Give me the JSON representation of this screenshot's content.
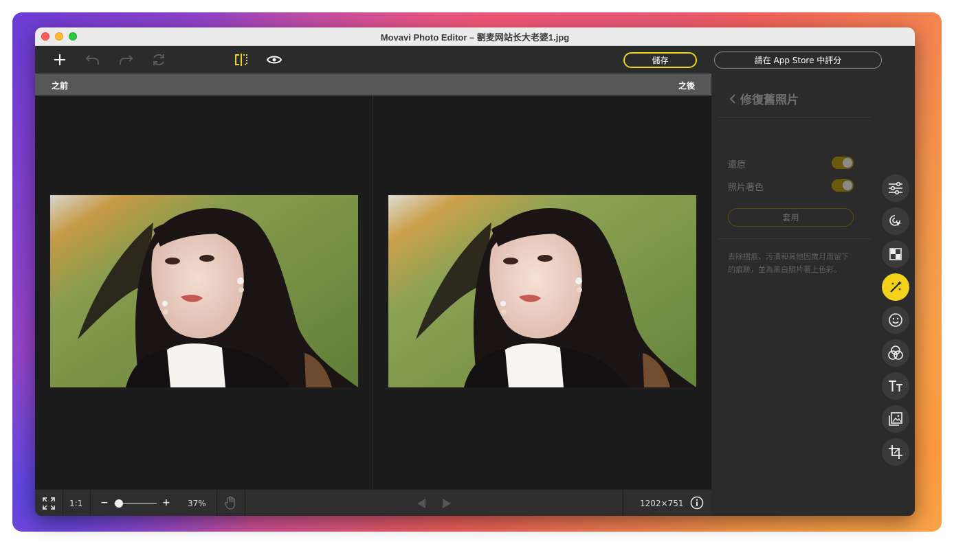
{
  "window": {
    "title": "Movavi Photo Editor – 劉麦网站长大老婆1.jpg"
  },
  "toolbar": {
    "save_label": "儲存",
    "rate_label": "請在 App Store 中評分",
    "icons": [
      "add-icon",
      "undo-icon",
      "redo-icon",
      "reset-icon",
      "compare-split-icon",
      "preview-eye-icon"
    ],
    "accent_color": "#f2d21a"
  },
  "compare": {
    "before_label": "之前",
    "after_label": "之後"
  },
  "statusbar": {
    "actual_size_label": "1:1",
    "zoom_minus": "−",
    "zoom_plus": "+",
    "zoom_value": "37%",
    "zoom_fraction": 0.12,
    "image_size": "1202×751"
  },
  "panel": {
    "title": "修復舊照片",
    "options": [
      {
        "label": "還原",
        "enabled": true
      },
      {
        "label": "照片著色",
        "enabled": true
      }
    ],
    "apply_label": "套用",
    "description": "去除摺痕、污漬和其他因歲月而留下的痕跡，並為黑白照片著上色彩。"
  },
  "rail": {
    "tools": [
      "adjust-icon",
      "select-icon",
      "retouch-icon",
      "restore-magic-icon",
      "face-icon",
      "filters-icon",
      "text-icon",
      "image-icon",
      "crop-icon"
    ],
    "active_tool": "restore-magic-icon"
  }
}
